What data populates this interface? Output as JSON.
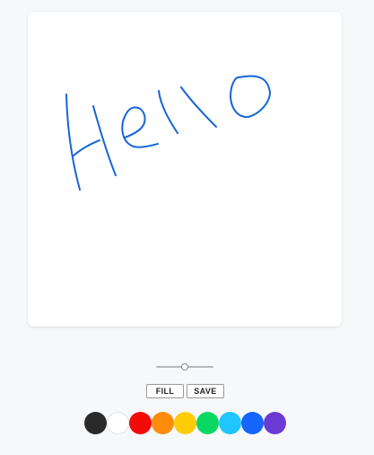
{
  "drawing": {
    "stroke_color": "#1565d8",
    "text": "Hello"
  },
  "brush_size": {
    "value": 0.5
  },
  "actions": {
    "fill_label": "FILL",
    "save_label": "SAVE"
  },
  "palette": [
    {
      "name": "black",
      "color": "#2a2a2a"
    },
    {
      "name": "white",
      "color": "#ffffff"
    },
    {
      "name": "red",
      "color": "#f50a0a"
    },
    {
      "name": "orange",
      "color": "#ff8c0a"
    },
    {
      "name": "yellow",
      "color": "#ffcc0a"
    },
    {
      "name": "green",
      "color": "#0ad862"
    },
    {
      "name": "cyan",
      "color": "#1fc6ff"
    },
    {
      "name": "blue",
      "color": "#1466ff"
    },
    {
      "name": "purple",
      "color": "#6a3bd2"
    }
  ]
}
